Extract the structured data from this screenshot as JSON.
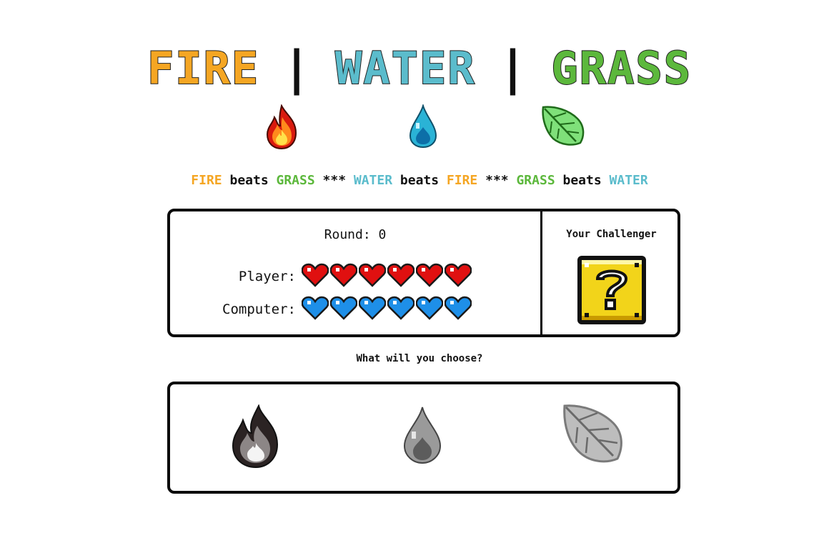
{
  "title": {
    "fire": "FIRE",
    "separator1": "|",
    "water": "WATER",
    "separator2": "|",
    "grass": "GRASS",
    "colors": {
      "fire": "#f5a623",
      "water": "#5bbccc",
      "grass": "#5cb83c"
    }
  },
  "element_icons": [
    "fire-icon",
    "water-drop-icon",
    "leaf-icon"
  ],
  "rules": {
    "parts": [
      {
        "text": "FIRE",
        "kind": "fire"
      },
      {
        "text": " beats ",
        "kind": "plain"
      },
      {
        "text": "GRASS",
        "kind": "grass"
      },
      {
        "text": " *** ",
        "kind": "plain"
      },
      {
        "text": "WATER",
        "kind": "water"
      },
      {
        "text": " beats ",
        "kind": "plain"
      },
      {
        "text": "FIRE",
        "kind": "fire"
      },
      {
        "text": " *** ",
        "kind": "plain"
      },
      {
        "text": "GRASS",
        "kind": "grass"
      },
      {
        "text": " beats ",
        "kind": "plain"
      },
      {
        "text": "WATER",
        "kind": "water"
      }
    ]
  },
  "scoreboard": {
    "round_label": "Round: 0",
    "player_label": "Player:",
    "computer_label": "Computer:",
    "player_hearts": 6,
    "computer_hearts": 6,
    "player_heart_color": "#e01010",
    "computer_heart_color": "#1e8fe8",
    "challenger_title": "Your Challenger",
    "challenger_icon": "question-block-icon"
  },
  "prompt": "What will you choose?",
  "choices": [
    {
      "name": "fire",
      "icon": "fire-choice-icon"
    },
    {
      "name": "water",
      "icon": "water-choice-icon"
    },
    {
      "name": "grass",
      "icon": "grass-choice-icon"
    }
  ]
}
